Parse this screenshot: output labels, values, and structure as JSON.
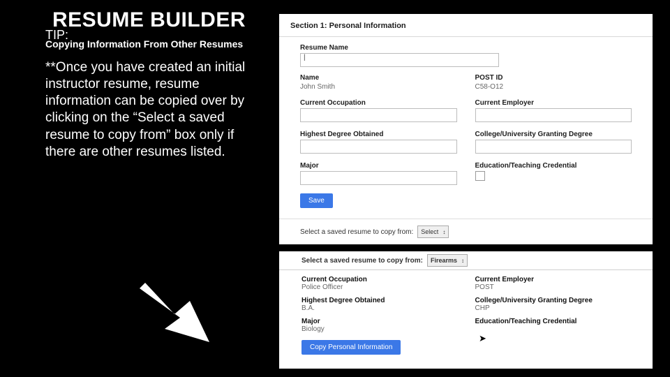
{
  "left": {
    "title": "RESUME BUILDER",
    "tip": "TIP:",
    "subtitle": "Copying Information From Other Resumes",
    "body": "**Once you have created an initial instructor resume, resume information can be copied over by clicking on the “Select a saved resume to copy from” box only if there are other resumes listed."
  },
  "panelA": {
    "sectionTitle": "Section 1: Personal Information",
    "resumeNameLabel": "Resume Name",
    "resumeNameValue": "|",
    "nameLabel": "Name",
    "nameValue": "John Smith",
    "postIdLabel": "POST ID",
    "postIdValue": "C58-O12",
    "occupationLabel": "Current Occupation",
    "employerLabel": "Current Employer",
    "degreeLabel": "Highest Degree Obtained",
    "collegeLabel": "College/University Granting Degree",
    "majorLabel": "Major",
    "credLabel": "Education/Teaching Credential",
    "saveLabel": "Save",
    "copyFromLabel": "Select a saved resume to copy from:",
    "copyFromSelect": "Select",
    "copyFromCaret": "↕"
  },
  "panelB": {
    "copyFromLabel": "Select a saved resume to copy from:",
    "copyFromSelect": "Firearms",
    "copyFromCaret": "↕",
    "occupationLabel": "Current Occupation",
    "occupationValue": "Police Officer",
    "employerLabel": "Current Employer",
    "employerValue": "POST",
    "degreeLabel": "Highest Degree Obtained",
    "degreeValue": "B.A.",
    "collegeLabel": "College/University Granting Degree",
    "collegeValue": "CHP",
    "majorLabel": "Major",
    "majorValue": "Biology",
    "credLabel": "Education/Teaching Credential",
    "credValue": "",
    "copyBtn": "Copy Personal Information"
  }
}
